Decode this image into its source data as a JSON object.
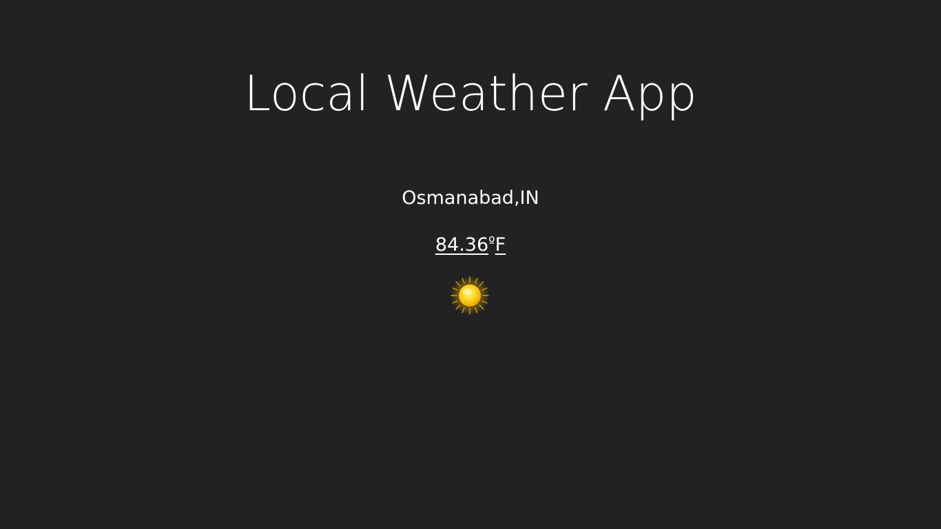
{
  "app": {
    "title": "Local Weather App"
  },
  "weather": {
    "location": "Osmanabad,IN",
    "temperature": "84.36",
    "degree_symbol": "º",
    "unit": "F",
    "condition_icon": "sun-icon"
  },
  "colors": {
    "background": "#222222",
    "text": "#ffffff",
    "sun_core": "#ffd21f",
    "sun_rays": "#f5b400"
  }
}
